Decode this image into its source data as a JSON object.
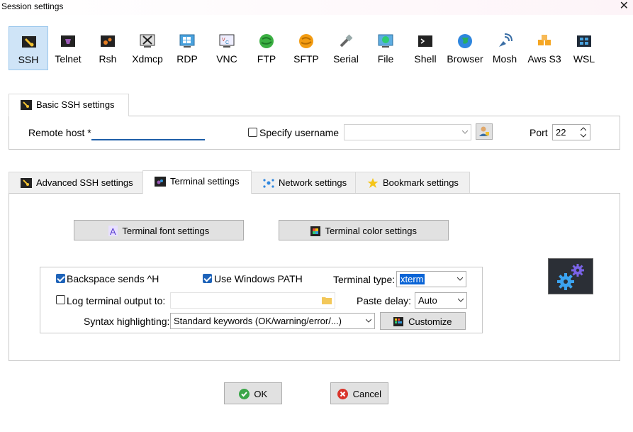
{
  "window": {
    "title": "Session settings"
  },
  "session_types": [
    {
      "label": "SSH",
      "icon": "ssh-icon",
      "selected": true
    },
    {
      "label": "Telnet",
      "icon": "telnet-icon"
    },
    {
      "label": "Rsh",
      "icon": "rsh-icon"
    },
    {
      "label": "Xdmcp",
      "icon": "xdmcp-icon"
    },
    {
      "label": "RDP",
      "icon": "rdp-icon"
    },
    {
      "label": "VNC",
      "icon": "vnc-icon"
    },
    {
      "label": "FTP",
      "icon": "ftp-icon"
    },
    {
      "label": "SFTP",
      "icon": "sftp-icon"
    },
    {
      "label": "Serial",
      "icon": "serial-icon"
    },
    {
      "label": "File",
      "icon": "file-icon"
    },
    {
      "label": "Shell",
      "icon": "shell-icon"
    },
    {
      "label": "Browser",
      "icon": "browser-icon"
    },
    {
      "label": "Mosh",
      "icon": "mosh-icon"
    },
    {
      "label": "Aws S3",
      "icon": "aws-s3-icon"
    },
    {
      "label": "WSL",
      "icon": "wsl-icon"
    }
  ],
  "basic": {
    "tab_label": "Basic SSH settings",
    "remote_host_label": "Remote host *",
    "remote_host_value": "",
    "specify_username_label": "Specify username",
    "specify_username_checked": false,
    "username_value": "",
    "port_label": "Port",
    "port_value": "22"
  },
  "tabs": [
    {
      "label": "Advanced SSH settings",
      "icon": "key-icon"
    },
    {
      "label": "Terminal settings",
      "icon": "terminal-icon",
      "active": true
    },
    {
      "label": "Network settings",
      "icon": "network-icon"
    },
    {
      "label": "Bookmark settings",
      "icon": "star-icon"
    }
  ],
  "terminal": {
    "font_button": "Terminal font settings",
    "color_button": "Terminal color settings",
    "backspace_label": "Backspace sends ^H",
    "backspace_checked": true,
    "windows_path_label": "Use Windows PATH",
    "windows_path_checked": true,
    "terminal_type_label": "Terminal type:",
    "terminal_type_value": "xterm",
    "log_output_label": "Log terminal output to:",
    "log_output_checked": false,
    "log_output_value": "",
    "paste_delay_label": "Paste delay:",
    "paste_delay_value": "Auto",
    "syntax_label": "Syntax highlighting:",
    "syntax_value": "Standard keywords (OK/warning/error/...)",
    "customize_button": "Customize"
  },
  "footer": {
    "ok_label": "OK",
    "cancel_label": "Cancel"
  },
  "colors": {
    "accent": "#1e63b9",
    "selected_bg": "#cfe4f7",
    "ok_green": "#3aa648",
    "cancel_red": "#d9342b"
  }
}
